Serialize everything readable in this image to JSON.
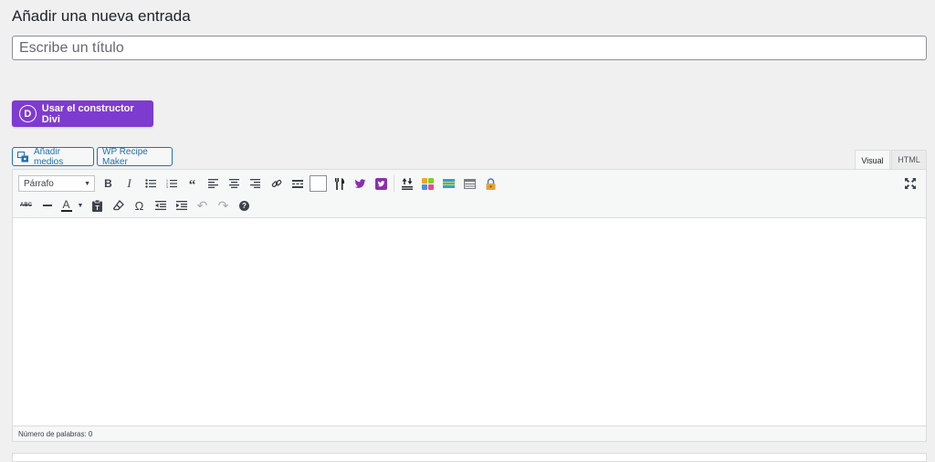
{
  "page": {
    "heading": "Añadir una nueva entrada",
    "title_placeholder": "Escribe un título"
  },
  "divi": {
    "logo_letter": "D",
    "label": "Usar el constructor Divi",
    "color": "#7e3bd0"
  },
  "media_buttons": {
    "add_media": "Añadir medios",
    "recipe_maker": "WP Recipe Maker"
  },
  "editor_tabs": {
    "visual": "Visual",
    "html": "HTML",
    "active": "Visual"
  },
  "toolbar": {
    "format_select": "Párrafo",
    "row1_icons": [
      "bold-icon",
      "italic-icon",
      "bullet-list-icon",
      "numbered-list-icon",
      "blockquote-icon",
      "align-left-icon",
      "align-center-icon",
      "align-right-icon",
      "link-icon",
      "read-more-icon",
      "toolbar-toggle-icon",
      "recipe-icon",
      "twitter-icon",
      "twitter-box-icon",
      "sort-icon",
      "grid-icon",
      "layers-icon",
      "table-icon",
      "lock-icon"
    ],
    "row2_icons": [
      "strikethrough-icon",
      "horizontal-line-icon",
      "text-color-icon",
      "paste-text-icon",
      "clear-formatting-icon",
      "special-character-icon",
      "outdent-icon",
      "indent-icon",
      "undo-icon",
      "redo-icon",
      "help-icon"
    ],
    "fullscreen_icon": "fullscreen-icon"
  },
  "statusbar": {
    "word_count": "Número de palabras: 0"
  }
}
